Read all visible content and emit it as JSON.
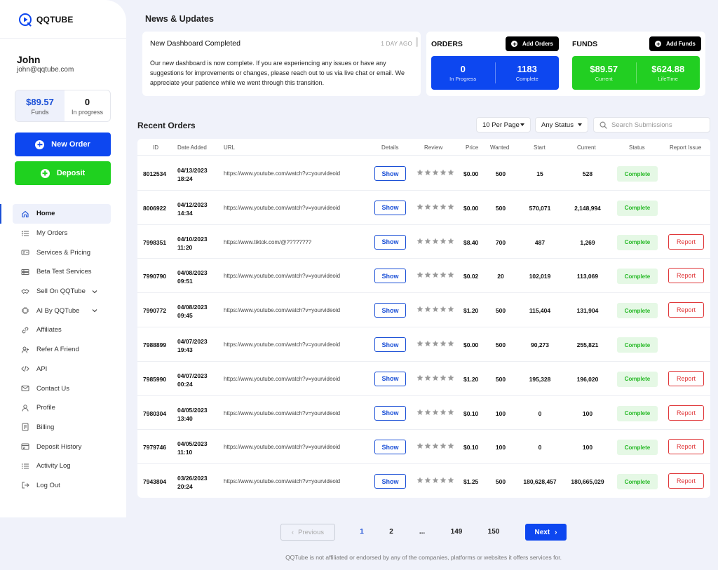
{
  "brand": {
    "name": "QQTUBE",
    "primary": "#0d47f0",
    "green": "#22cf22",
    "red": "#e0393b"
  },
  "user": {
    "name": "John",
    "email": "john@qqtube.com",
    "funds": "$89.57",
    "funds_label": "Funds",
    "in_progress": "0",
    "in_progress_label": "In progress"
  },
  "actions": {
    "new_order": "New Order",
    "deposit": "Deposit"
  },
  "nav": [
    {
      "label": "Home",
      "icon": "home-icon",
      "active": true
    },
    {
      "label": "My Orders",
      "icon": "list-icon"
    },
    {
      "label": "Services & Pricing",
      "icon": "price-tag-icon"
    },
    {
      "label": "Beta Test Services",
      "icon": "server-icon"
    },
    {
      "label": "Sell On QQTube",
      "icon": "handshake-icon",
      "expandable": true
    },
    {
      "label": "AI By QQTube",
      "icon": "chip-icon",
      "expandable": true
    },
    {
      "label": "Affiliates",
      "icon": "link-icon"
    },
    {
      "label": "Refer A Friend",
      "icon": "user-plus-icon"
    },
    {
      "label": "API",
      "icon": "code-icon"
    },
    {
      "label": "Contact Us",
      "icon": "mail-icon"
    },
    {
      "label": "Profile",
      "icon": "user-icon"
    },
    {
      "label": "Billing",
      "icon": "billing-icon"
    },
    {
      "label": "Deposit History",
      "icon": "history-icon"
    },
    {
      "label": "Activity Log",
      "icon": "activity-icon"
    },
    {
      "label": "Log Out",
      "icon": "logout-icon"
    }
  ],
  "news": {
    "section_title": "News & Updates",
    "headline": "New Dashboard Completed",
    "time": "1 DAY AGO",
    "body": "Our new dashboard is now complete.  If you are experiencing any issues or have any suggestions for improvements or changes, please reach out to us via live chat or email.  We appreciate your patience while we went through this transition."
  },
  "orders_summary": {
    "title": "ORDERS",
    "button": "Add Orders",
    "in_progress": "0",
    "in_progress_label": "In Progress",
    "complete": "1183",
    "complete_label": "Complete"
  },
  "funds_summary": {
    "title": "FUNDS",
    "button": "Add Funds",
    "current": "$89.57",
    "current_label": "Current",
    "lifetime": "$624.88",
    "lifetime_label": "LifeTime"
  },
  "recent": {
    "title": "Recent Orders",
    "per_page": "10 Per Page",
    "status_filter": "Any Status",
    "search_placeholder": "Search Submissions",
    "columns": [
      "ID",
      "Date Added",
      "URL",
      "Details",
      "Review",
      "Price",
      "Wanted",
      "Start",
      "Current",
      "Status",
      "Report Issue"
    ],
    "show_label": "Show",
    "report_label": "Report",
    "rows": [
      {
        "id": "8012534",
        "date": "04/13/2023",
        "time": "18:24",
        "url": "https://www.youtube.com/watch?v=yourvideoid",
        "price": "$0.00",
        "wanted": "500",
        "start": "15",
        "current": "528",
        "status": "Complete",
        "report": false
      },
      {
        "id": "8006922",
        "date": "04/12/2023",
        "time": "14:34",
        "url": "https://www.youtube.com/watch?v=yourvideoid",
        "price": "$0.00",
        "wanted": "500",
        "start": "570,071",
        "current": "2,148,994",
        "status": "Complete",
        "report": false
      },
      {
        "id": "7998351",
        "date": "04/10/2023",
        "time": "11:20",
        "url": "https://www.tiktok.com/@????????",
        "price": "$8.40",
        "wanted": "700",
        "start": "487",
        "current": "1,269",
        "status": "Complete",
        "report": true
      },
      {
        "id": "7990790",
        "date": "04/08/2023",
        "time": "09:51",
        "url": "https://www.youtube.com/watch?v=yourvideoid",
        "price": "$0.02",
        "wanted": "20",
        "start": "102,019",
        "current": "113,069",
        "status": "Complete",
        "report": true
      },
      {
        "id": "7990772",
        "date": "04/08/2023",
        "time": "09:45",
        "url": "https://www.youtube.com/watch?v=yourvideoid",
        "price": "$1.20",
        "wanted": "500",
        "start": "115,404",
        "current": "131,904",
        "status": "Complete",
        "report": true
      },
      {
        "id": "7988899",
        "date": "04/07/2023",
        "time": "19:43",
        "url": "https://www.youtube.com/watch?v=yourvideoid",
        "price": "$0.00",
        "wanted": "500",
        "start": "90,273",
        "current": "255,821",
        "status": "Complete",
        "report": false
      },
      {
        "id": "7985990",
        "date": "04/07/2023",
        "time": "00:24",
        "url": "https://www.youtube.com/watch?v=yourvideoid",
        "price": "$1.20",
        "wanted": "500",
        "start": "195,328",
        "current": "196,020",
        "status": "Complete",
        "report": true
      },
      {
        "id": "7980304",
        "date": "04/05/2023",
        "time": "13:40",
        "url": "https://www.youtube.com/watch?v=yourvideoid",
        "price": "$0.10",
        "wanted": "100",
        "start": "0",
        "current": "100",
        "status": "Complete",
        "report": true
      },
      {
        "id": "7979746",
        "date": "04/05/2023",
        "time": "11:10",
        "url": "https://www.youtube.com/watch?v=yourvideoid",
        "price": "$0.10",
        "wanted": "100",
        "start": "0",
        "current": "100",
        "status": "Complete",
        "report": true
      },
      {
        "id": "7943804",
        "date": "03/26/2023",
        "time": "20:24",
        "url": "https://www.youtube.com/watch?v=yourvideoid",
        "price": "$1.25",
        "wanted": "500",
        "start": "180,628,457",
        "current": "180,665,029",
        "status": "Complete",
        "report": true
      }
    ]
  },
  "pagination": {
    "prev": "Previous",
    "next": "Next",
    "pages": [
      "1",
      "2",
      "...",
      "149",
      "150"
    ],
    "current": "1"
  },
  "footer": "QQTube is not affiliated or endorsed by any of the companies, platforms or websites it offers services for."
}
